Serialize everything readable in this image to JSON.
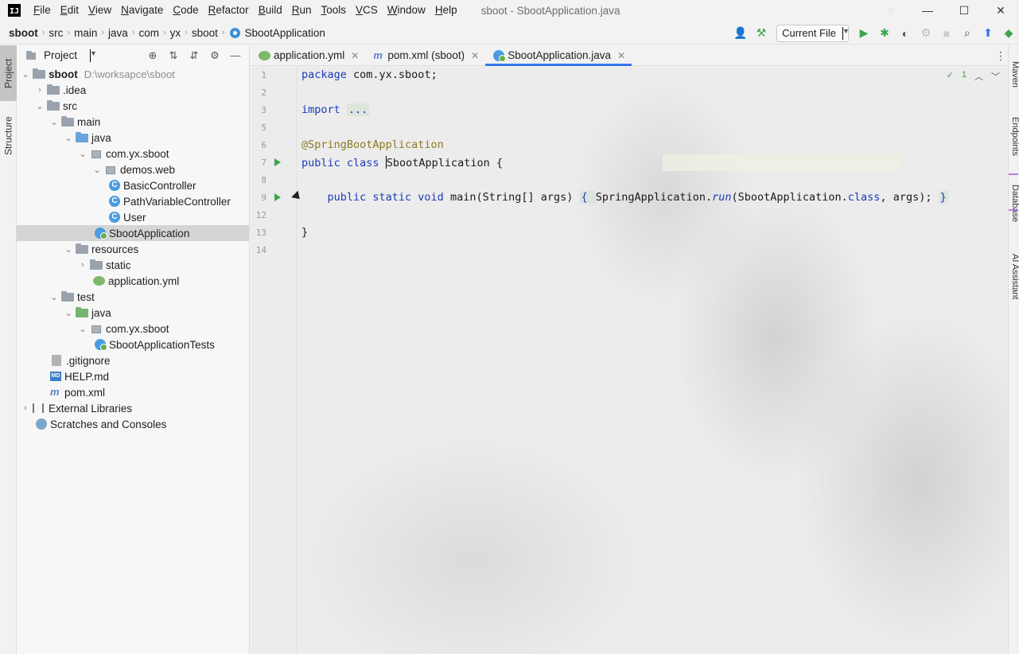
{
  "window": {
    "title": "sboot - SbootApplication.java",
    "logo": "IJ"
  },
  "menu": [
    "File",
    "Edit",
    "View",
    "Navigate",
    "Code",
    "Refactor",
    "Build",
    "Run",
    "Tools",
    "VCS",
    "Window",
    "Help"
  ],
  "breadcrumb": [
    "sboot",
    "src",
    "main",
    "java",
    "com",
    "yx",
    "sboot",
    "SbootApplication"
  ],
  "toolbar": {
    "run_config": "Current File"
  },
  "left_stripe": {
    "project_tab": "Project",
    "structure_tab": "Structure"
  },
  "project_panel": {
    "title": "Project",
    "tree": [
      {
        "label": "sboot",
        "path": "D:\\worksapce\\sboot"
      },
      {
        "label": ".idea"
      },
      {
        "label": "src"
      },
      {
        "label": "main"
      },
      {
        "label": "java"
      },
      {
        "label": "com.yx.sboot"
      },
      {
        "label": "demos.web"
      },
      {
        "label": "BasicController"
      },
      {
        "label": "PathVariableController"
      },
      {
        "label": "User"
      },
      {
        "label": "SbootApplication"
      },
      {
        "label": "resources"
      },
      {
        "label": "static"
      },
      {
        "label": "application.yml"
      },
      {
        "label": "test"
      },
      {
        "label": "java"
      },
      {
        "label": "com.yx.sboot"
      },
      {
        "label": "SbootApplicationTests"
      },
      {
        "label": ".gitignore"
      },
      {
        "label": "HELP.md"
      },
      {
        "label": "pom.xml"
      },
      {
        "label": "External Libraries"
      },
      {
        "label": "Scratches and Consoles"
      }
    ]
  },
  "tabs": [
    {
      "label": "application.yml",
      "icon": "yml-icon"
    },
    {
      "label": "pom.xml (sboot)",
      "icon": "maven-icon"
    },
    {
      "label": "SbootApplication.java",
      "icon": "spring-class-icon",
      "active": true
    }
  ],
  "editor": {
    "line_numbers": [
      "1",
      "2",
      "3",
      "5",
      "6",
      "7",
      "8",
      "9",
      "12",
      "13",
      "14"
    ],
    "code": {
      "l1_kw": "package",
      "l1_rest": " com.yx.sboot;",
      "l3_kw": "import",
      "l3_fold": "...",
      "l6": "@SpringBootApplication",
      "l7_kw": "public class",
      "l7_name": "SbootApplication",
      "l7_rest": " {",
      "l9_kw": "public static void",
      "l9_method": " main",
      "l9_params": "(String[] args) ",
      "l9_body_open": "{ ",
      "l9_cls": "SpringApplication.",
      "l9_run": "run",
      "l9_args_a": "(SbootApplication.",
      "l9_class_kw": "class",
      "l9_args_b": ", args); ",
      "l9_body_close": "}",
      "l13": "}"
    },
    "inspection_count": "1"
  },
  "right_stripe": [
    "Maven",
    "Endpoints",
    "Database",
    "AI Assistant"
  ]
}
